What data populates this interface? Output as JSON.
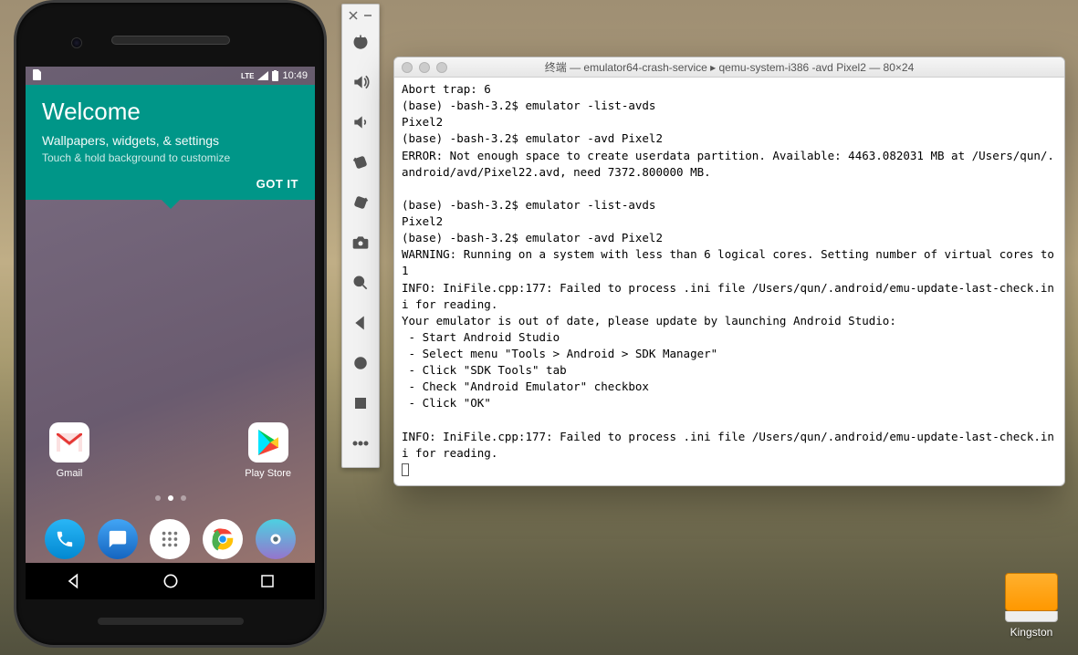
{
  "phone": {
    "statusbar": {
      "time": "10:49",
      "lte": "LTE"
    },
    "welcome": {
      "title": "Welcome",
      "sub1": "Wallpapers, widgets, & settings",
      "sub2": "Touch & hold background to customize",
      "gotit": "GOT IT"
    },
    "apps": {
      "gmail": "Gmail",
      "playstore": "Play Store"
    }
  },
  "toolbar_icons": [
    "close",
    "minimize",
    "power",
    "volume-up",
    "volume-down",
    "rotate-ccw",
    "rotate-cw",
    "camera",
    "zoom",
    "back",
    "home",
    "overview",
    "more"
  ],
  "terminal": {
    "title": "终端 — emulator64-crash-service ▸ qemu-system-i386 -avd Pixel2 — 80×24",
    "lines": [
      "Abort trap: 6",
      "(base) -bash-3.2$ emulator -list-avds",
      "Pixel2",
      "(base) -bash-3.2$ emulator -avd Pixel2",
      "ERROR: Not enough space to create userdata partition. Available: 4463.082031 MB at /Users/qun/.android/avd/Pixel22.avd, need 7372.800000 MB.",
      "",
      "(base) -bash-3.2$ emulator -list-avds",
      "Pixel2",
      "(base) -bash-3.2$ emulator -avd Pixel2",
      "WARNING: Running on a system with less than 6 logical cores. Setting number of virtual cores to 1",
      "INFO: IniFile.cpp:177: Failed to process .ini file /Users/qun/.android/emu-update-last-check.ini for reading.",
      "Your emulator is out of date, please update by launching Android Studio:",
      " - Start Android Studio",
      " - Select menu \"Tools > Android > SDK Manager\"",
      " - Click \"SDK Tools\" tab",
      " - Check \"Android Emulator\" checkbox",
      " - Click \"OK\"",
      "",
      "INFO: IniFile.cpp:177: Failed to process .ini file /Users/qun/.android/emu-update-last-check.ini for reading."
    ]
  },
  "drive": {
    "label": "Kingston"
  }
}
